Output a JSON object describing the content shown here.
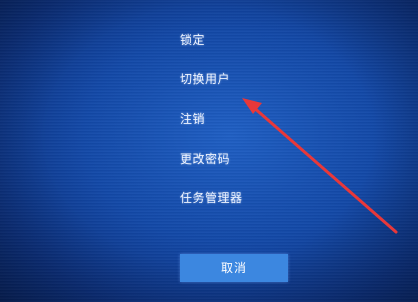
{
  "menu": {
    "items": [
      {
        "label": "锁定"
      },
      {
        "label": "切换用户"
      },
      {
        "label": "注销"
      },
      {
        "label": "更改密码"
      },
      {
        "label": "任务管理器"
      }
    ]
  },
  "cancel_button": {
    "label": "取消"
  },
  "colors": {
    "background": "#1349a8",
    "button": "#3c87e0",
    "annotation_arrow": "#e8383a"
  },
  "annotation": {
    "icon": "red-arrow-icon"
  }
}
